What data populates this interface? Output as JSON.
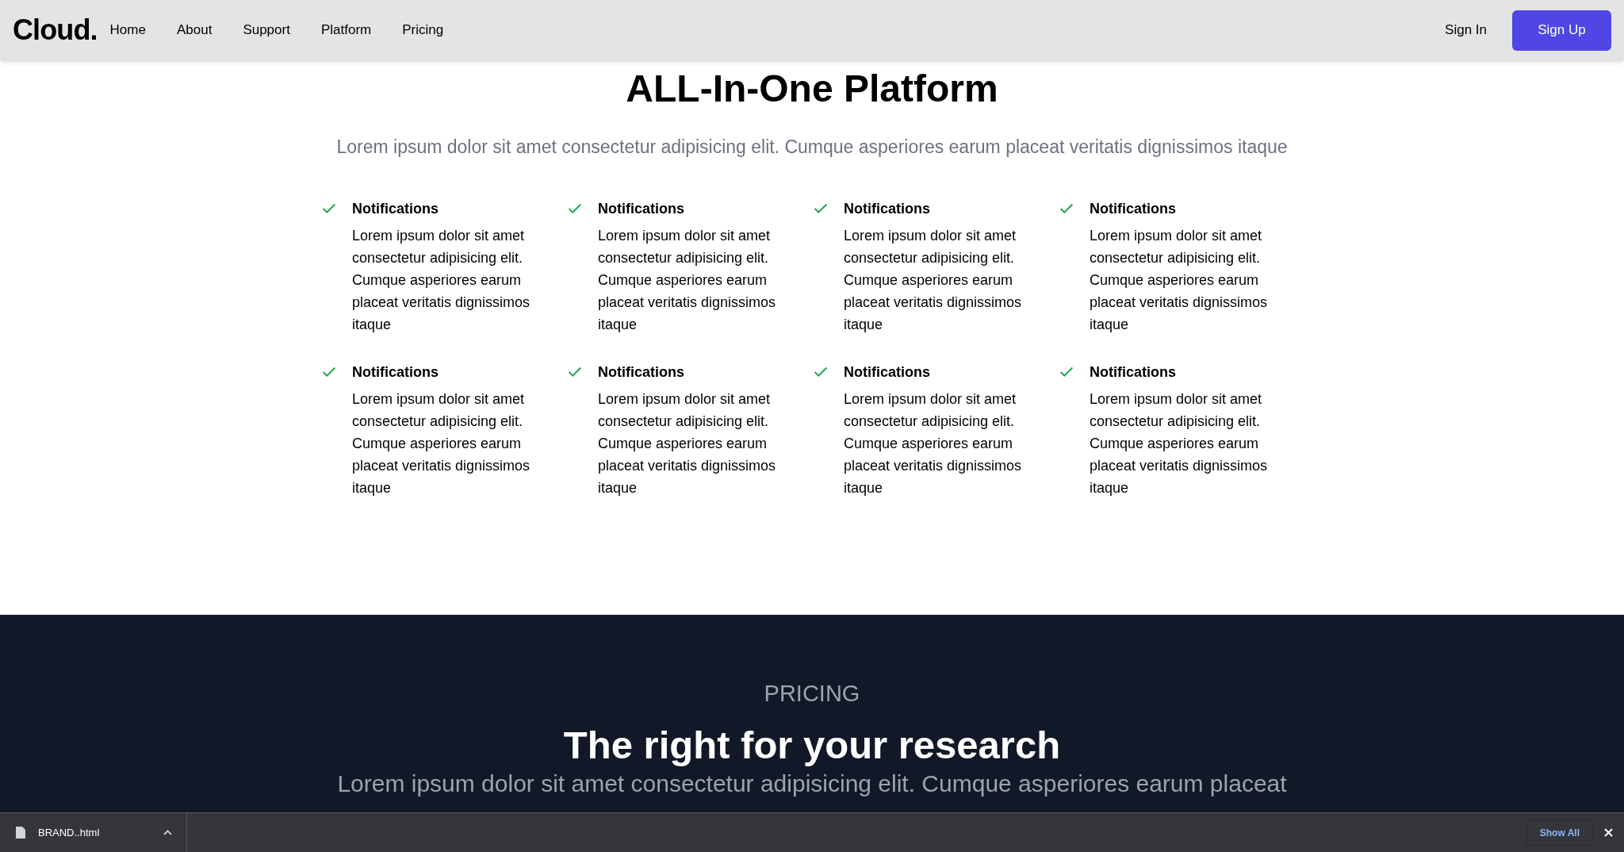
{
  "nav": {
    "logo": "Cloud.",
    "links": [
      "Home",
      "About",
      "Support",
      "Platform",
      "Pricing"
    ],
    "sign_in": "Sign In",
    "sign_up": "Sign Up"
  },
  "features_section": {
    "title": "ALL-In-One Platform",
    "subtitle": "Lorem ipsum dolor sit amet consectetur adipisicing elit. Cumque asperiores earum placeat veritatis dignissimos itaque",
    "features": [
      {
        "title": "Notifications",
        "text": "Lorem ipsum dolor sit amet consectetur adipisicing elit. Cumque asperiores earum placeat veritatis dignissimos itaque"
      },
      {
        "title": "Notifications",
        "text": "Lorem ipsum dolor sit amet consectetur adipisicing elit. Cumque asperiores earum placeat veritatis dignissimos itaque"
      },
      {
        "title": "Notifications",
        "text": "Lorem ipsum dolor sit amet consectetur adipisicing elit. Cumque asperiores earum placeat veritatis dignissimos itaque"
      },
      {
        "title": "Notifications",
        "text": "Lorem ipsum dolor sit amet consectetur adipisicing elit. Cumque asperiores earum placeat veritatis dignissimos itaque"
      },
      {
        "title": "Notifications",
        "text": "Lorem ipsum dolor sit amet consectetur adipisicing elit. Cumque asperiores earum placeat veritatis dignissimos itaque"
      },
      {
        "title": "Notifications",
        "text": "Lorem ipsum dolor sit amet consectetur adipisicing elit. Cumque asperiores earum placeat veritatis dignissimos itaque"
      },
      {
        "title": "Notifications",
        "text": "Lorem ipsum dolor sit amet consectetur adipisicing elit. Cumque asperiores earum placeat veritatis dignissimos itaque"
      },
      {
        "title": "Notifications",
        "text": "Lorem ipsum dolor sit amet consectetur adipisicing elit. Cumque asperiores earum placeat veritatis dignissimos itaque"
      }
    ]
  },
  "pricing_section": {
    "eyebrow": "PRICING",
    "title": "The right for your research",
    "subtitle": "Lorem ipsum dolor sit amet consectetur adipisicing elit. Cumque asperiores earum placeat"
  },
  "download_bar": {
    "file": "BRAND..html",
    "show_all": "Show All"
  }
}
